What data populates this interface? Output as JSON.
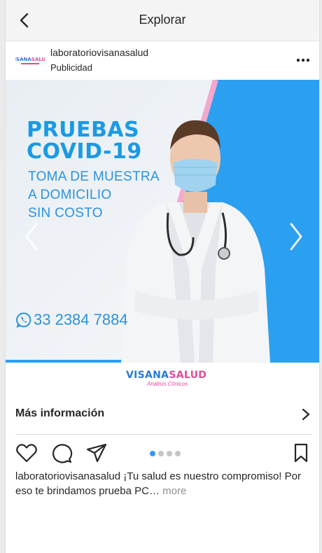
{
  "topbar": {
    "title": "Explorar"
  },
  "post": {
    "username": "laboratoriovisanasalud",
    "sponsored_label": "Publicidad"
  },
  "media": {
    "headline_line1": "PRUEBAS",
    "headline_line2": "COVID-19",
    "sub_line1": "TOMA DE MUESTRA",
    "sub_line2": "A DOMICILIO",
    "sub_line3": "SIN COSTO",
    "phone": "33 2384 7884",
    "logo_part1": "VISANA",
    "logo_part2": "SALUD",
    "logo_sub": "Análisis Clínicos",
    "carousel_count": 4,
    "carousel_active": 1
  },
  "cta": {
    "label": "Más información"
  },
  "caption": {
    "username": "laboratoriovisanasalud",
    "text": " ¡Tu salud es nuestro compromiso! Por eso te brindamos prueba PC…",
    "more_label": "more"
  },
  "colors": {
    "accent_blue": "#2b92df",
    "pink": "#e04b9a",
    "dot_active": "#3897f0"
  },
  "icons": [
    "back-arrow-icon",
    "more-dots-icon",
    "carousel-prev-icon",
    "carousel-next-icon",
    "whatsapp-icon",
    "chevron-right-icon",
    "heart-icon",
    "comment-icon",
    "share-icon",
    "bookmark-icon"
  ]
}
